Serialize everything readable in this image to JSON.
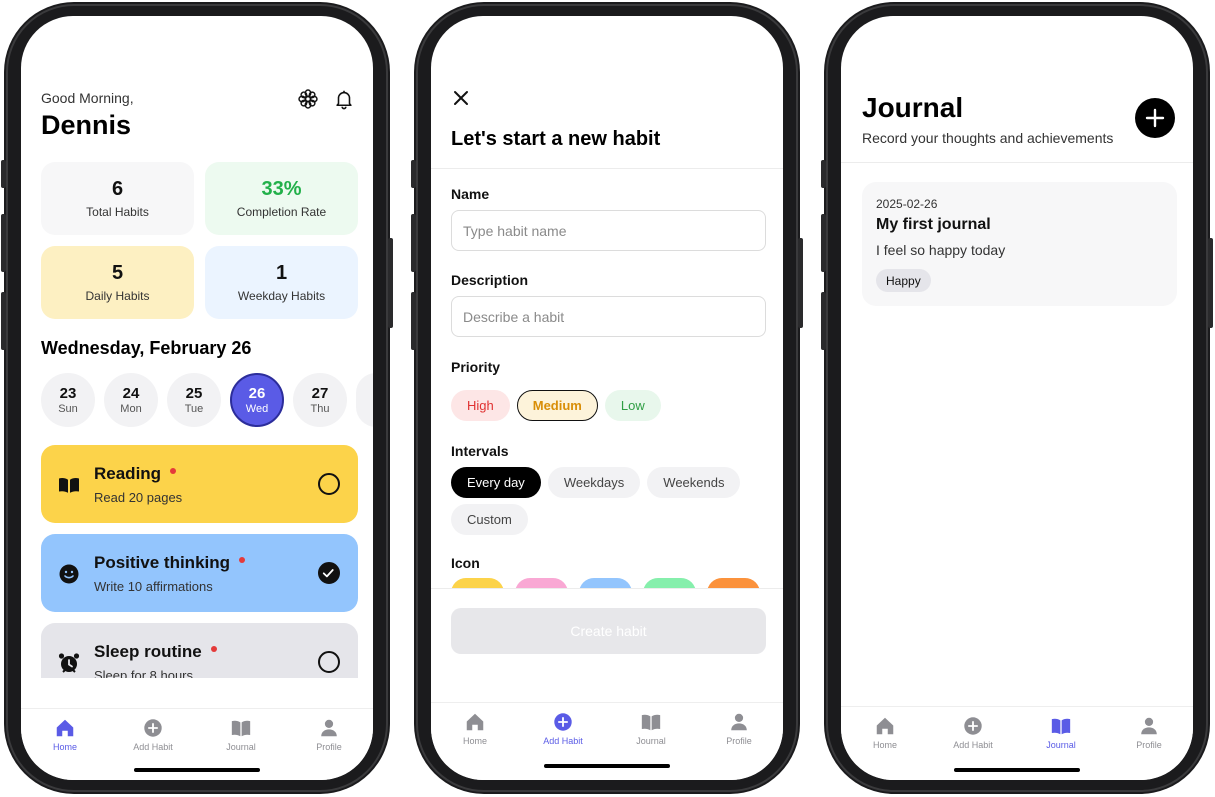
{
  "tabs": [
    {
      "label": "Home",
      "icon": "home-icon"
    },
    {
      "label": "Add Habit",
      "icon": "plus-circle-icon"
    },
    {
      "label": "Journal",
      "icon": "book-icon"
    },
    {
      "label": "Profile",
      "icon": "person-icon"
    }
  ],
  "home": {
    "greeting": "Good Morning,",
    "name": "Dennis",
    "icons": [
      "flower-icon",
      "bell-icon"
    ],
    "stats": [
      {
        "value": "6",
        "label": "Total Habits"
      },
      {
        "value": "33%",
        "label": "Completion Rate"
      },
      {
        "value": "5",
        "label": "Daily Habits"
      },
      {
        "value": "1",
        "label": "Weekday Habits"
      }
    ],
    "date_heading": "Wednesday, February 26",
    "days": [
      {
        "day": "23",
        "weekday": "Sun"
      },
      {
        "day": "24",
        "weekday": "Mon"
      },
      {
        "day": "25",
        "weekday": "Tue"
      },
      {
        "day": "26",
        "weekday": "Wed",
        "selected": true
      },
      {
        "day": "27",
        "weekday": "Thu"
      }
    ],
    "habits": [
      {
        "title": "Reading",
        "subtitle": "Read 20 pages",
        "icon": "book-icon",
        "done": false,
        "color": "#fcd34a"
      },
      {
        "title": "Positive thinking",
        "subtitle": "Write 10 affirmations",
        "icon": "smile-icon",
        "done": true,
        "color": "#93c5fd"
      },
      {
        "title": "Sleep routine",
        "subtitle": "Sleep for 8 hours",
        "icon": "alarm-clock-icon",
        "done": false,
        "color": "#e5e5ea"
      }
    ],
    "active_tab": "Home"
  },
  "new_habit": {
    "title": "Let's start a new habit",
    "name_label": "Name",
    "name_placeholder": "Type habit name",
    "description_label": "Description",
    "description_placeholder": "Describe a habit",
    "priority_label": "Priority",
    "priorities": [
      "High",
      "Medium",
      "Low"
    ],
    "selected_priority": "Medium",
    "intervals_label": "Intervals",
    "intervals": [
      "Every day",
      "Weekdays",
      "Weekends",
      "Custom"
    ],
    "selected_interval": "Every day",
    "icon_label": "Icon",
    "icon_colors": [
      "#fcd34a",
      "#f9a8d4",
      "#93c5fd",
      "#86efac",
      "#fb923c"
    ],
    "create_button": "Create habit",
    "active_tab": "Add Habit"
  },
  "journal": {
    "title": "Journal",
    "subtitle": "Record your thoughts and achievements",
    "entries": [
      {
        "date": "2025-02-26",
        "title": "My first journal",
        "body": "I feel so happy today",
        "tag": "Happy"
      }
    ],
    "active_tab": "Journal"
  },
  "colors": {
    "accent": "#5a5be6",
    "success": "#22b04a",
    "priority_high": "#e03131",
    "priority_medium": "#d98e07",
    "priority_low": "#2f9e44"
  }
}
